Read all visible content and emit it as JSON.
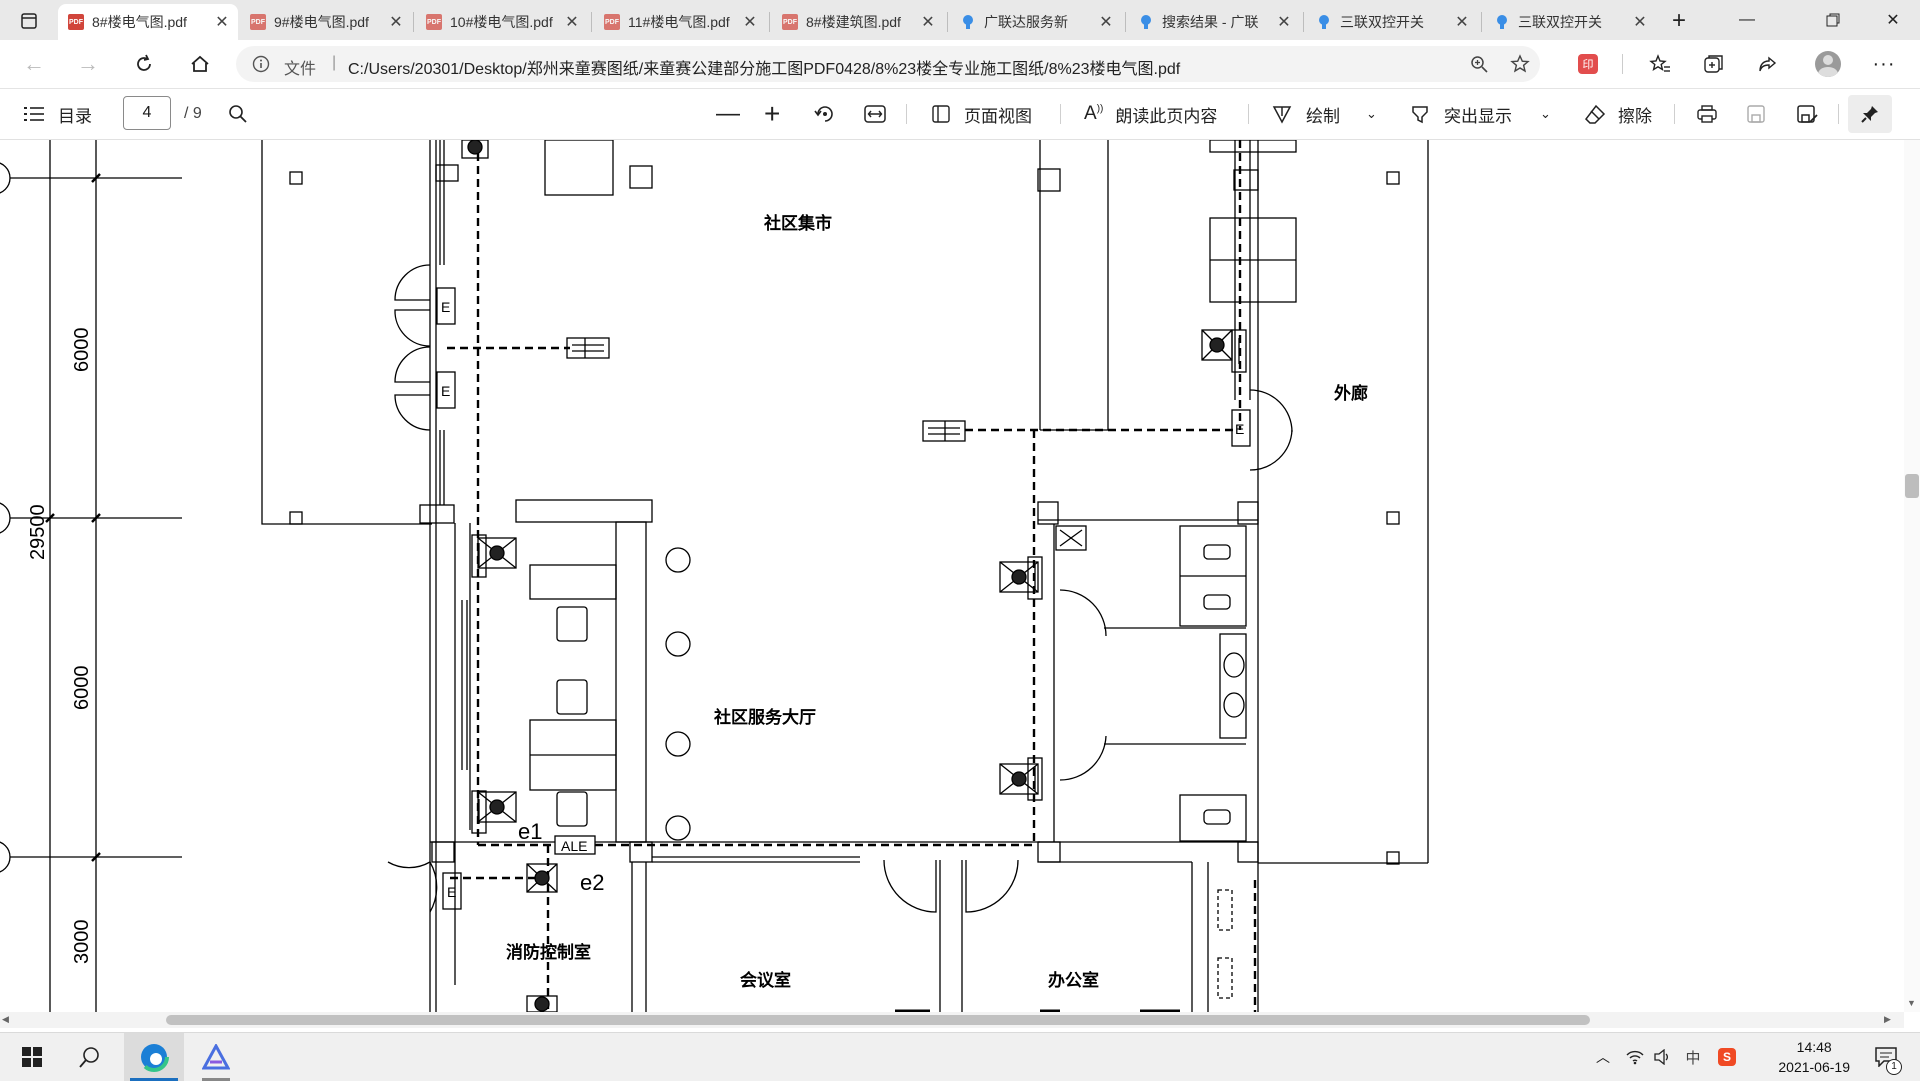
{
  "browser": {
    "tabs": [
      {
        "label": "8#楼电气图.pdf",
        "icon": "pdf-icon",
        "active": true
      },
      {
        "label": "9#楼电气图.pdf",
        "icon": "pdf-icon"
      },
      {
        "label": "10#楼电气图.pdf",
        "icon": "pdf-icon"
      },
      {
        "label": "11#楼电气图.pdf",
        "icon": "pdf-icon"
      },
      {
        "label": "8#楼建筑图.pdf",
        "icon": "pdf-icon"
      },
      {
        "label": "广联达服务新",
        "icon": "bulb-icon"
      },
      {
        "label": "搜索结果 - 广联",
        "icon": "bulb-icon"
      },
      {
        "label": "三联双控开关",
        "icon": "bulb-icon"
      },
      {
        "label": "三联双控开关",
        "icon": "bulb-icon"
      }
    ],
    "address": {
      "scheme_label": "文件",
      "url": "C:/Users/20301/Desktop/郑州来童赛图纸/来童赛公建部分施工图PDF0428/8%23楼全专业施工图纸/8%23楼电气图.pdf"
    }
  },
  "pdf_toolbar": {
    "toc_label": "目录",
    "page_current": "4",
    "page_total": "/ 9",
    "page_view_label": "页面视图",
    "read_aloud_label": "朗读此页内容",
    "draw_label": "绘制",
    "highlight_label": "突出显示",
    "erase_label": "擦除"
  },
  "drawing": {
    "rooms": {
      "market": "社区集市",
      "corridor": "外廊",
      "service_hall": "社区服务大厅",
      "fire_control": "消防控制室",
      "meeting": "会议室",
      "office": "办公室"
    },
    "dimensions": {
      "d1": "6000",
      "d2": "29500",
      "d3": "6000",
      "d4": "3000"
    },
    "labels": {
      "e1": "e1",
      "e2": "e2",
      "ale": "ALE",
      "exit": "E"
    }
  },
  "taskbar": {
    "time": "14:48",
    "date": "2021-06-19",
    "ime": "中",
    "notification_count": "1"
  }
}
